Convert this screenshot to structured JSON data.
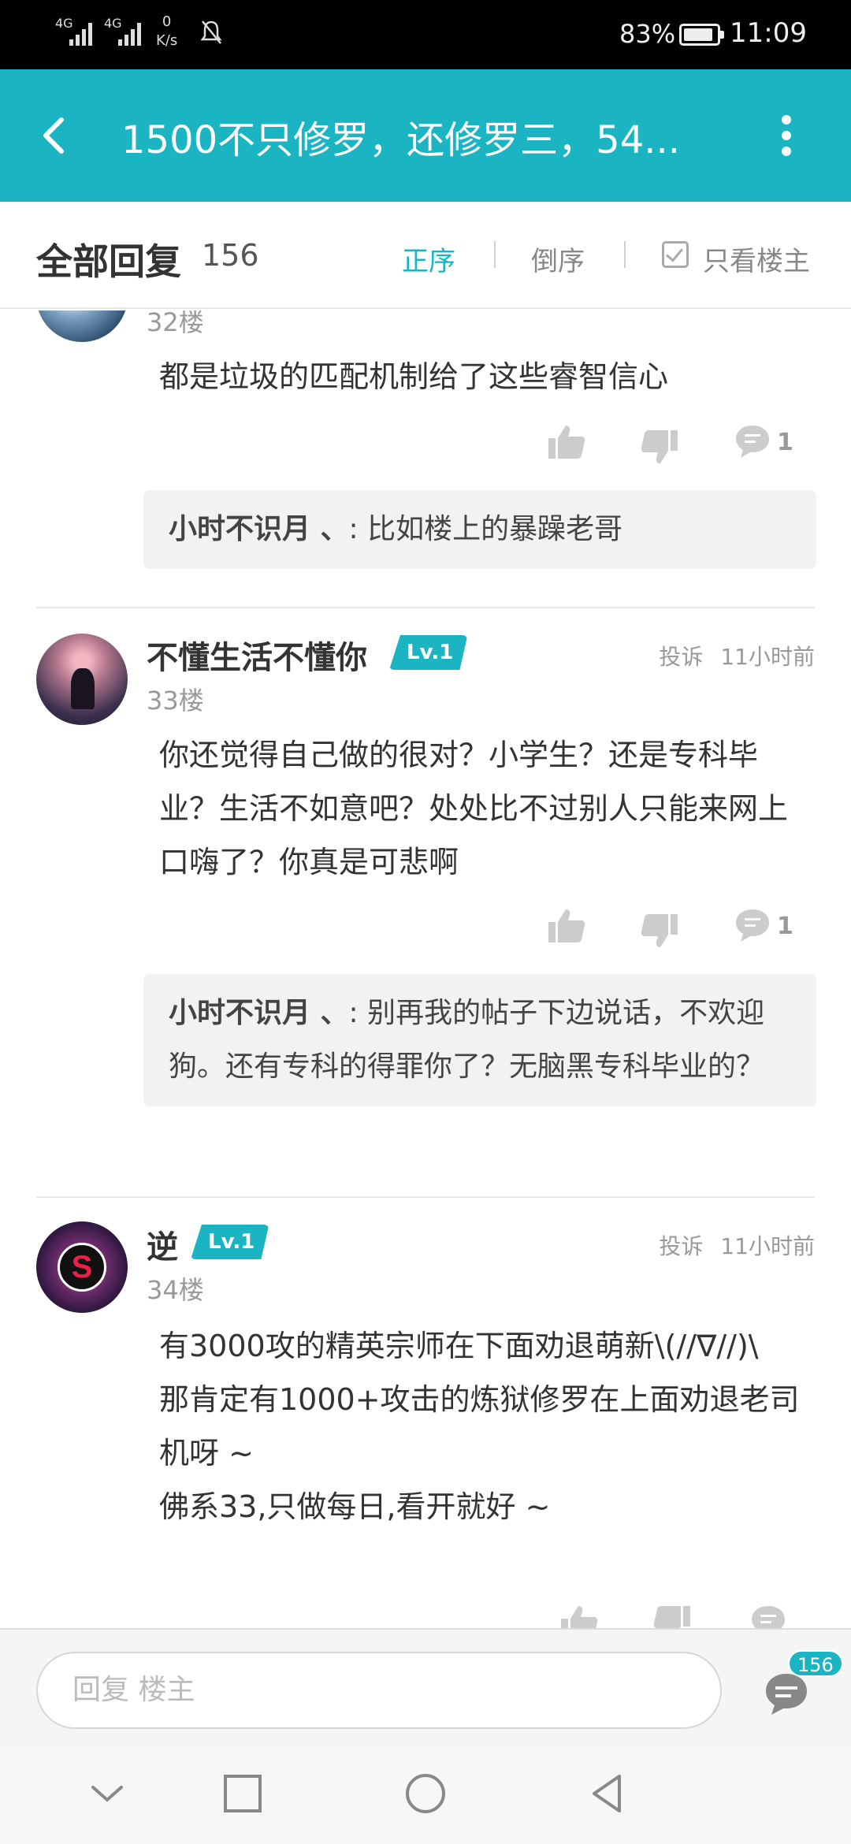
{
  "status_bar": {
    "signal1": "4G",
    "signal2": "4G",
    "net_speed_value": "0",
    "net_speed_unit": "K/s",
    "battery": "83%",
    "time": "11:09"
  },
  "header": {
    "title": "1500不只修罗，还修罗三，54..."
  },
  "filter": {
    "title": "全部回复",
    "count": "156",
    "order_asc": "正序",
    "order_desc": "倒序",
    "only_op": "只看楼主"
  },
  "posts": [
    {
      "floor": "32楼",
      "content": "都是垃圾的匹配机制给了这些睿智信心",
      "comment_count": "1",
      "quote": {
        "name": "小时不识月 、",
        "text": ": 比如楼上的暴躁老哥"
      }
    },
    {
      "username": "不懂生活不懂你",
      "level": "Lv.1",
      "report": "投诉",
      "time": "11小时前",
      "floor": "33楼",
      "content": "你还觉得自己做的很对？小学生？还是专科毕业？生活不如意吧？处处比不过别人只能来网上口嗨了？你真是可悲啊",
      "comment_count": "1",
      "quote": {
        "name": "小时不识月 、",
        "text": ": 别再我的帖子下边说话，不欢迎狗。还有专科的得罪你了？无脑黑专科毕业的？"
      }
    },
    {
      "username": "逆",
      "level": "Lv.1",
      "report": "投诉",
      "time": "11小时前",
      "floor": "34楼",
      "content_lines": [
        "有3000攻的精英宗师在下面劝退萌新\\(//∇//)\\",
        "那肯定有1000+攻击的炼狱修罗在上面劝退老司机呀 ~",
        "佛系33,只做每日,看开就好 ~"
      ]
    }
  ],
  "reply_bar": {
    "placeholder": "回复  楼主",
    "badge": "156"
  },
  "icons": {
    "accent": "#1ab4c3"
  }
}
